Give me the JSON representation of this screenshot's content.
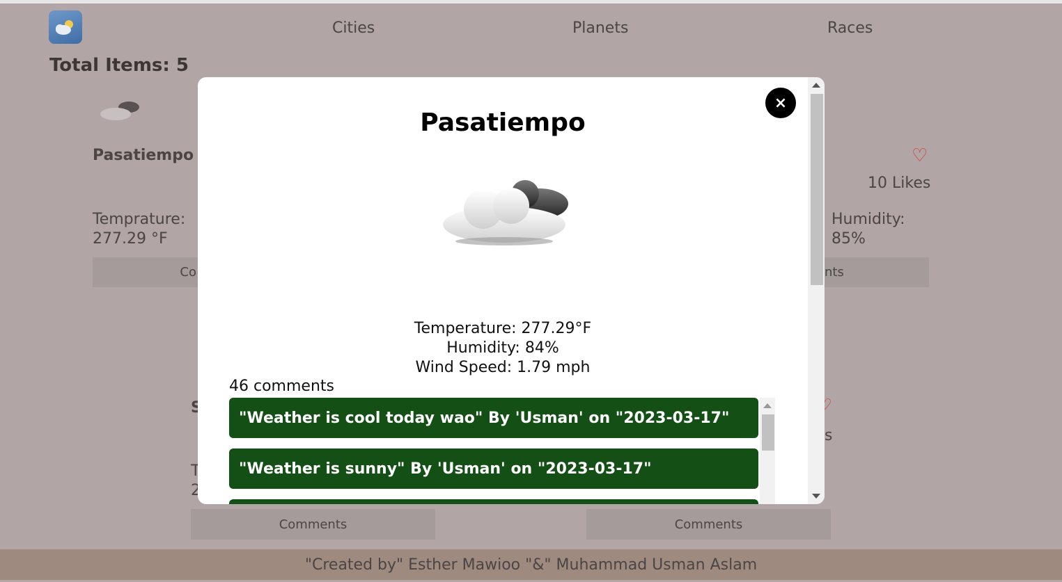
{
  "nav": {
    "links": [
      "Cities",
      "Planets",
      "Races"
    ]
  },
  "summary": {
    "total_items": "Total Items: 5"
  },
  "background_card": {
    "city": "Pasatiempo",
    "likes": "10 Likes",
    "temperature_label": "Temprature:",
    "temperature_value": "277.29 °F",
    "humidity_label": "Humidity:",
    "humidity_value": "85%",
    "comments_left_fragment": "Co",
    "comments_right_fragment": "nts"
  },
  "background_row2": {
    "heading_fragment": "S",
    "likes_fragment": "s",
    "temp_fragment_1": "T",
    "temp_fragment_2": "2",
    "comments_button_left": "Comments",
    "comments_button_right": "Comments"
  },
  "modal": {
    "title": "Pasatiempo",
    "close_label": "×",
    "temperature": "Temperature: 277.29°F",
    "humidity": "Humidity: 84%",
    "wind_speed": "Wind Speed: 1.79 mph",
    "comment_count": "46 comments",
    "comments": [
      "\"Weather is cool today wao\" By 'Usman' on \"2023-03-17\"",
      "\"Weather is sunny\" By 'Usman' on \"2023-03-17\""
    ]
  },
  "footer": {
    "credit": "\"Created by\" Esther Mawioo \"&\" Muhammad Usman Aslam"
  },
  "colors": {
    "background": "#b1a5a5",
    "comment_bg": "#145016",
    "heart": "#dd3333",
    "footer_bg": "#9e8a7f"
  }
}
